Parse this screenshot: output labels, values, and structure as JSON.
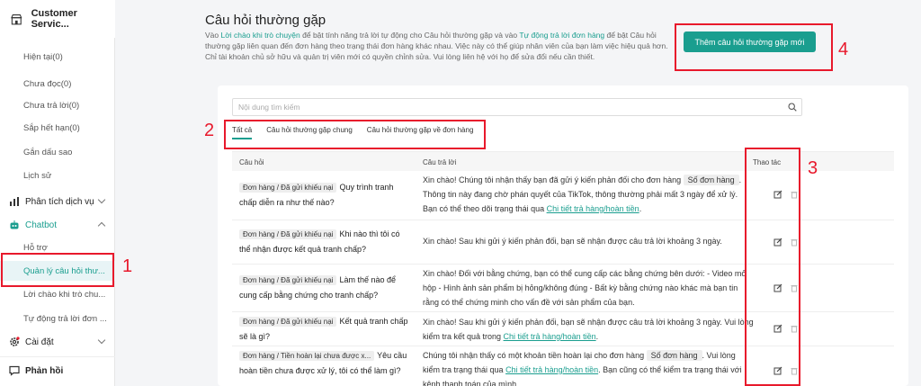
{
  "sidebar": {
    "brand": "Customer Servic...",
    "items": [
      {
        "label": "Hiện tại(0)"
      },
      {
        "label": "Chưa đọc(0)"
      },
      {
        "label": "Chưa trả lời(0)"
      },
      {
        "label": "Sắp hết hạn(0)"
      },
      {
        "label": "Gắn dấu sao"
      },
      {
        "label": "Lịch sử"
      }
    ],
    "analytics": "Phân tích dịch vụ",
    "chatbot": "Chatbot",
    "chatbot_items": [
      {
        "label": "Hỗ trợ"
      },
      {
        "label": "Quản lý câu hỏi thư..."
      },
      {
        "label": "Lời chào khi trò chu..."
      },
      {
        "label": "Tự động trả lời đơn ..."
      }
    ],
    "settings": "Cài đặt",
    "feedback": "Phản hồi"
  },
  "page": {
    "title": "Câu hỏi thường gặp",
    "desc_parts": {
      "p1": "Vào ",
      "link1": "Lời chào khi trò chuyện",
      "p2": " để bật tính năng trả lời tự động cho Câu hỏi thường gặp và vào ",
      "link2": "Tự động trả lời đơn hàng",
      "p3": " để bật Câu hỏi thường gặp liên quan đến đơn hàng theo trạng thái đơn hàng khác nhau. Việc này có thể giúp nhân viên của bạn làm việc hiệu quả hơn. Chỉ tài khoản chủ sở hữu và quản trị viên mới có quyền chỉnh sửa. Vui lòng liên hệ với họ để sửa đổi nếu cần thiết."
    },
    "add_button": "Thêm câu hỏi thường gặp mới",
    "search_placeholder": "Nội dung tìm kiếm",
    "tabs": [
      "Tất cả",
      "Câu hỏi thường gặp chung",
      "Câu hỏi thường gặp về đơn hàng"
    ],
    "columns": [
      "Câu hỏi",
      "Câu trả lời",
      "Thao tác"
    ],
    "rows": [
      {
        "tag": "Đơn hàng / Đã gửi khiếu nại",
        "question": "Quy trình tranh chấp diễn ra như thế nào?",
        "a1": "Xin chào! Chúng tôi nhận thấy bạn đã gửi ý kiến phản đối cho đơn hàng",
        "a_tag": "Số đơn hàng",
        "a2": ". Thông tin này đang chờ phán quyết của TikTok, thông thường phải mất 3 ngày để xử lý. Bạn có thể theo dõi trạng thái qua ",
        "a_link": "Chi tiết trả hàng/hoàn tiền",
        "a3": "."
      },
      {
        "tag": "Đơn hàng / Đã gửi khiếu nại",
        "question": "Khi nào thì tôi có thể nhận được kết quả tranh chấp?",
        "a1": "Xin chào! Sau khi gửi ý kiến phản đối, bạn sẽ nhận được câu trả lời khoảng 3 ngày."
      },
      {
        "tag": "Đơn hàng / Đã gửi khiếu nại",
        "question": "Làm thế nào để cung cấp bằng chứng cho tranh chấp?",
        "a1": "Xin chào! Đối với bằng chứng, bạn có thể cung cấp các bằng chứng bên dưới: - Video mở hộp - Hình ảnh sản phẩm bị hỏng/không đúng - Bất kỳ bằng chứng nào khác mà bạn tin rằng có thể chứng minh cho vấn đề với sản phẩm của bạn."
      },
      {
        "tag": "Đơn hàng / Đã gửi khiếu nại",
        "question": "Kết quả tranh chấp sẽ là gì?",
        "a1": "Xin chào! Sau khi gửi ý kiến phản đối, bạn sẽ nhận được câu trả lời khoảng 3 ngày. Vui lòng kiểm tra kết quả trong ",
        "a_link": "Chi tiết trả hàng/hoàn tiền",
        "a3": "."
      },
      {
        "tag": "Đơn hàng / Tiền hoàn lại chưa được x...",
        "question": "Yêu cầu hoàn tiền chưa được xử lý, tôi có thể làm gì?",
        "a1": "Chúng tôi nhận thấy có một khoản tiền hoàn lại cho đơn hàng",
        "a_tag": "Số đơn hàng",
        "a2": ". Vui lòng kiểm tra trạng thái qua ",
        "a_link": "Chi tiết trả hàng/hoàn tiền",
        "a3": ". Bạn cũng có thể kiểm tra trạng thái với kênh thanh toán của mình."
      }
    ]
  },
  "annotations": [
    "1",
    "2",
    "3",
    "4"
  ],
  "colors": {
    "accent": "#1a9e8f",
    "annotation": "#e8192c"
  }
}
